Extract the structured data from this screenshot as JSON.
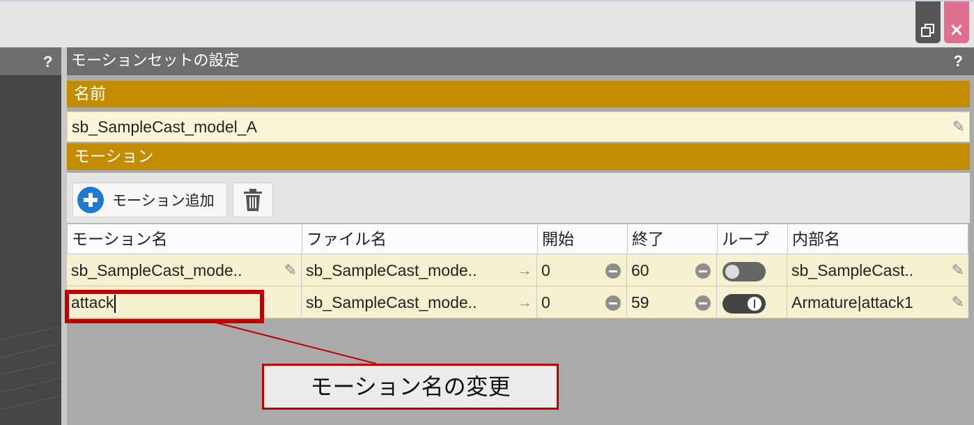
{
  "window": {
    "restore_icon": "restore-icon",
    "close_icon": "close-icon"
  },
  "left_panel": {
    "help": "?"
  },
  "panel": {
    "title": "モーションセットの設定",
    "help": "?"
  },
  "name_section": {
    "label": "名前",
    "value": "sb_SampleCast_model_A"
  },
  "motion_section": {
    "label": "モーション",
    "add_button": "モーション追加"
  },
  "table": {
    "headers": [
      "モーション名",
      "ファイル名",
      "開始",
      "終了",
      "ループ",
      "内部名"
    ],
    "rows": [
      {
        "motion_name": "sb_SampleCast_mode..",
        "file_name": "sb_SampleCast_mode..",
        "start": "0",
        "end": "60",
        "loop": false,
        "internal_name": "sb_SampleCast.."
      },
      {
        "motion_name": "attack",
        "file_name": "sb_SampleCast_mode..",
        "start": "0",
        "end": "59",
        "loop": true,
        "internal_name": "Armature|attack1"
      }
    ]
  },
  "annotation": {
    "label": "モーション名の変更",
    "color": "#c00000"
  },
  "colors": {
    "section_header": "#c48c00",
    "row_bg": "#f7f0d0",
    "add_icon": "#1f78d1"
  }
}
